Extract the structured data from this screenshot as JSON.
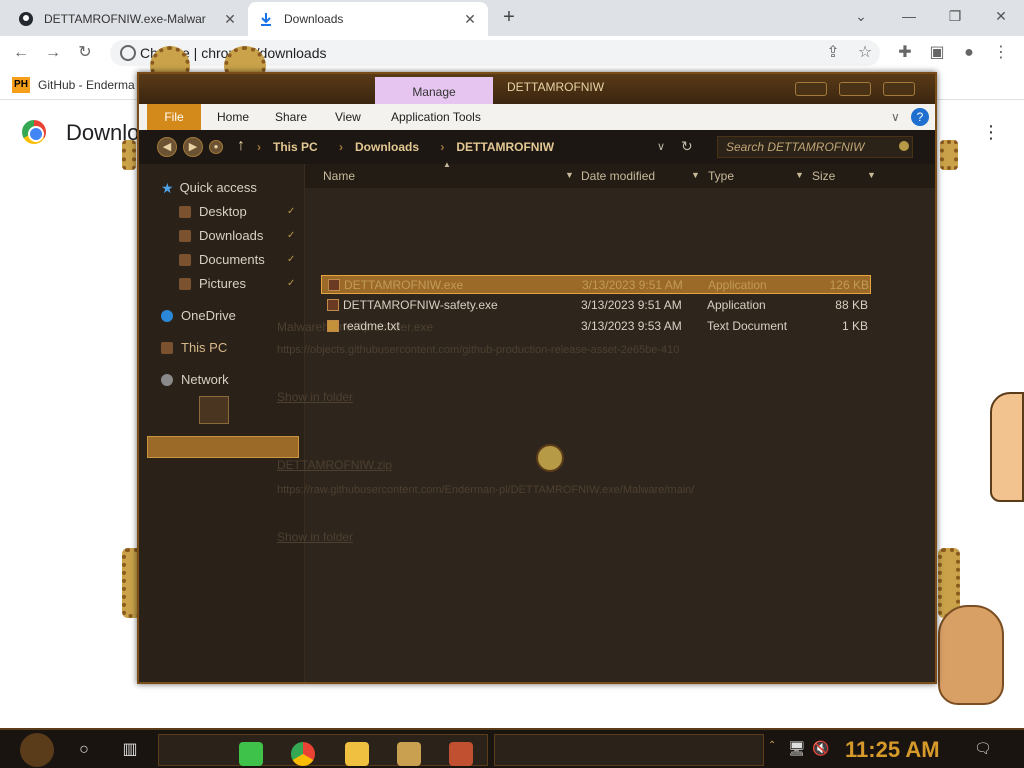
{
  "browser": {
    "tabs": [
      {
        "label": "DETTAMROFNIW.exe-Malwar",
        "active": false,
        "icon": "github-icon"
      },
      {
        "label": "Downloads",
        "active": true,
        "icon": "download-icon"
      }
    ],
    "address": "Chrome | chrome://downloads",
    "bookmark": {
      "badge": "PH",
      "label": "GitHub - Enderma"
    },
    "page_title": "Downloads"
  },
  "downloads_page_ghost": [
    {
      "text": "Malwarehome/Aproceder.exe",
      "kind": "filename"
    },
    {
      "text": "https://objects.githubusercontent.com/github-production-release-asset-2e65be-410",
      "kind": "url"
    },
    {
      "text": "Show in folder",
      "kind": "link"
    },
    {
      "text": "DETTAMROFNIW.zip",
      "kind": "filename"
    },
    {
      "text": "https://raw.githubusercontent.com/Enderman-pl/DETTAMROFNIW.exe/Malware/main/",
      "kind": "url"
    },
    {
      "text": "Show in folder",
      "kind": "link"
    }
  ],
  "explorer": {
    "title": "DETTAMROFNIW",
    "manage_label": "Manage",
    "ribbon_tabs": [
      "File",
      "Home",
      "Share",
      "View",
      "Application Tools"
    ],
    "breadcrumbs": [
      "This PC",
      "Downloads",
      "DETTAMROFNIW"
    ],
    "search_placeholder": "Search DETTAMROFNIW",
    "nav": {
      "quick_access": "Quick access",
      "items": [
        "Desktop",
        "Downloads",
        "Documents",
        "Pictures"
      ],
      "onedrive": "OneDrive",
      "this_pc": "This PC",
      "network": "Network"
    },
    "columns": [
      "Name",
      "Date modified",
      "Type",
      "Size"
    ],
    "files": [
      {
        "name": "DETTAMROFNIW.exe",
        "date": "3/13/2023 9:51 AM",
        "type": "Application",
        "size": "126 KB",
        "selected": true
      },
      {
        "name": "DETTAMROFNIW-safety.exe",
        "date": "3/13/2023 9:51 AM",
        "type": "Application",
        "size": "88 KB",
        "selected": false
      },
      {
        "name": "readme.txt",
        "date": "3/13/2023 9:53 AM",
        "type": "Text Document",
        "size": "1 KB",
        "selected": false
      }
    ]
  },
  "taskbar": {
    "time": "11:25 AM"
  }
}
